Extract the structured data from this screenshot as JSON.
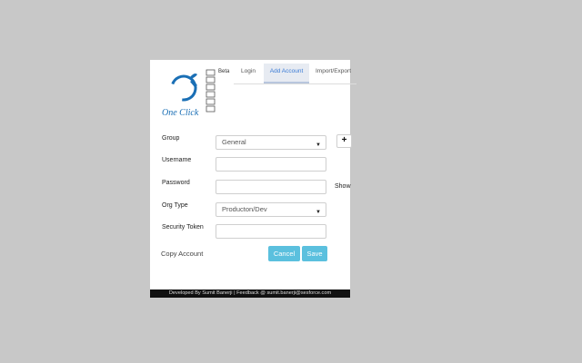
{
  "header": {
    "beta_label": "Beta",
    "logo_text": "One Click"
  },
  "tabs": [
    {
      "label": "Login",
      "active": false
    },
    {
      "label": "Add Account",
      "active": true
    },
    {
      "label": "Import/Export",
      "active": false
    }
  ],
  "form": {
    "group": {
      "label": "Group",
      "value": "General"
    },
    "add_group_label": "+",
    "username": {
      "label": "Username",
      "value": ""
    },
    "password": {
      "label": "Password",
      "value": "",
      "show_label": "Show"
    },
    "org_type": {
      "label": "Org Type",
      "value": "Producton/Dev"
    },
    "security_token": {
      "label": "Security Token",
      "value": ""
    }
  },
  "actions": {
    "copy_account": "Copy Account",
    "cancel": "Cancel",
    "save": "Save"
  },
  "footer": {
    "text": "Developed By Sumit Banerji | Feedback @ sumit.banerji@sesforce.com"
  },
  "colors": {
    "page_background": "#c8c8c8",
    "accent_button": "#5bc0de",
    "logo_blue": "#1a6fb5",
    "active_tab_bg": "#e7ebf2",
    "footer_bg": "#111111"
  }
}
